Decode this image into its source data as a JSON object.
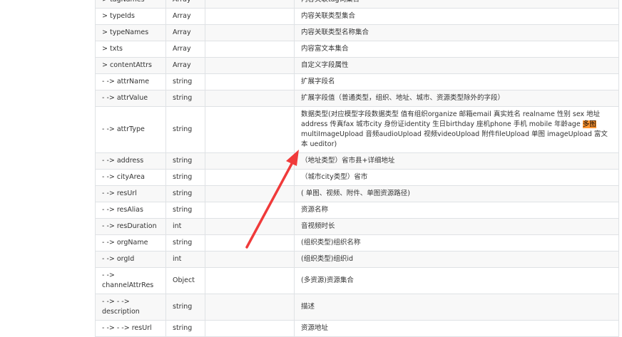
{
  "rows": [
    {
      "name": "> tagNames",
      "type": "Array",
      "desc": "内容关联tag词集合"
    },
    {
      "name": "> typeIds",
      "type": "Array",
      "desc": "内容关联类型集合"
    },
    {
      "name": "> typeNames",
      "type": "Array",
      "desc": "内容关联类型名称集合"
    },
    {
      "name": "> txts",
      "type": "Array",
      "desc": "内容富文本集合"
    },
    {
      "name": "> contentAttrs",
      "type": "Array",
      "desc": "自定义字段属性"
    },
    {
      "name": "- -> attrName",
      "type": "string",
      "desc": "扩展字段名"
    },
    {
      "name": "- -> attrValue",
      "type": "string",
      "desc": "扩展字段值（普通类型，组织、地址、城市、资源类型除外的字段）"
    },
    {
      "name": "- -> attrType",
      "type": "string",
      "desc_parts": {
        "pre": "数据类型(对应模型字段数据类型 值有组织organize 邮箱email 真实姓名 realname 性别 sex 地址 address 传真fax 城市city 身份证identity 生日birthday 座机phone 手机 mobile 年龄age ",
        "highlight": "多图",
        "post": "multiImageUpload 音频audioUpload 视频videoUpload 附件fileUpload 单图 imageUpload 富文本 ueditor)"
      }
    },
    {
      "name": "- -> address",
      "type": "string",
      "desc": "（地址类型）省市县+详细地址"
    },
    {
      "name": "- -> cityArea",
      "type": "string",
      "desc": "（城市city类型）省市"
    },
    {
      "name": "- -> resUrl",
      "type": "string",
      "desc": "( 单图、视频、附件、单图资源路径)"
    },
    {
      "name": "- -> resAlias",
      "type": "string",
      "desc": "资源名称"
    },
    {
      "name": "- -> resDuration",
      "type": "int",
      "desc": "音视频时长"
    },
    {
      "name": "- -> orgName",
      "type": "string",
      "desc": "(组织类型)组织名称"
    },
    {
      "name": "- -> orgId",
      "type": "int",
      "desc": "(组织类型)组织id"
    },
    {
      "name": "- -> channelAttrRes",
      "type": "Object",
      "desc": "(多资源)资源集合"
    },
    {
      "name": "- -> - -> description",
      "type": "string",
      "desc": "描述"
    },
    {
      "name": "- -> - -> resUrl",
      "type": "string",
      "desc": "资源地址"
    }
  ],
  "colors": {
    "highlight": "#ff9632",
    "arrow": "#f03a3a",
    "stripe": "#f8f8f8"
  }
}
